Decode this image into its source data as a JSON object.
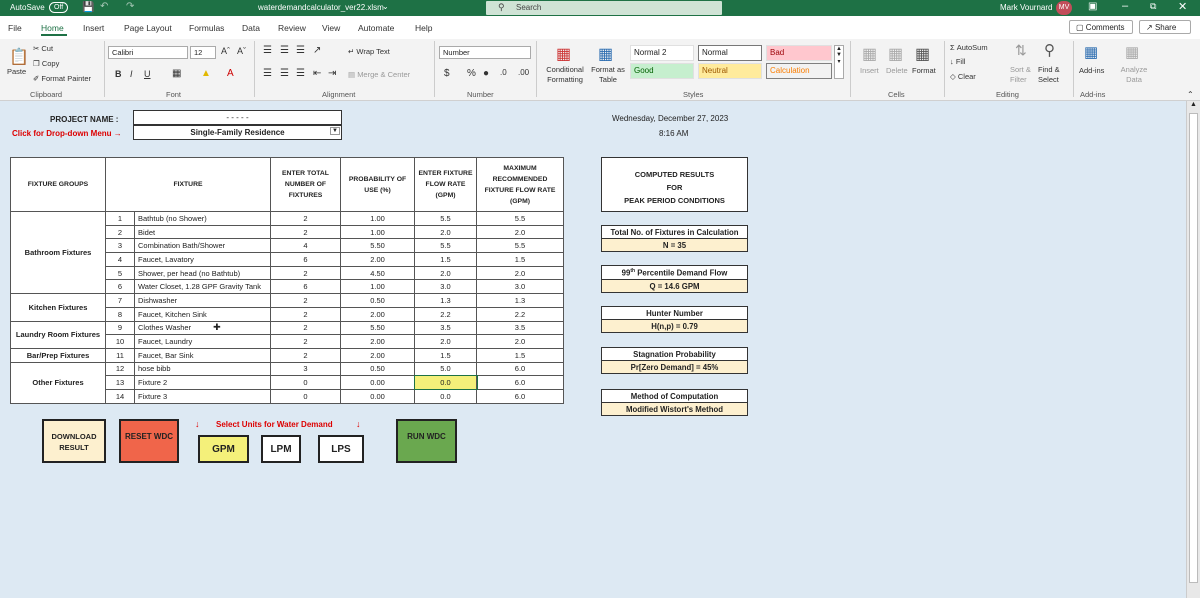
{
  "titlebar": {
    "autosave": "AutoSave",
    "autosave_state": "Off",
    "filename": "waterdemandcalculator_ver22.xlsm",
    "search": "Search",
    "user": "Mark Vournard",
    "initials": "MV"
  },
  "menu": {
    "tabs": [
      "File",
      "Home",
      "Insert",
      "Page Layout",
      "Formulas",
      "Data",
      "Review",
      "View",
      "Automate",
      "Help"
    ],
    "comments": "Comments",
    "share": "Share"
  },
  "ribbon": {
    "clipboard": {
      "paste": "Paste",
      "cut": "Cut",
      "copy": "Copy",
      "painter": "Format Painter",
      "label": "Clipboard"
    },
    "font": {
      "name": "Calibri",
      "size": "12",
      "label": "Font"
    },
    "alignment": {
      "wrap": "Wrap Text",
      "merge": "Merge & Center",
      "label": "Alignment"
    },
    "number": {
      "format": "Number",
      "label": "Number"
    },
    "styles": {
      "conditional": "Conditional Formatting",
      "format_table": "Format as Table",
      "normal2": "Normal 2",
      "normal": "Normal",
      "bad": "Bad",
      "good": "Good",
      "neutral": "Neutral",
      "calculation": "Calculation",
      "label": "Styles"
    },
    "cells": {
      "insert": "Insert",
      "delete": "Delete",
      "format": "Format",
      "label": "Cells"
    },
    "editing": {
      "autosum": "AutoSum",
      "fill": "Fill",
      "clear": "Clear",
      "sort": "Sort & Filter",
      "find": "Find & Select",
      "label": "Editing"
    },
    "addins": {
      "addins": "Add-ins",
      "analyze": "Analyze Data",
      "label": "Add-ins"
    }
  },
  "sheet": {
    "project_label": "PROJECT NAME :",
    "project_value": "- - - - -",
    "dropdown_label": "Click for Drop-down Menu →",
    "dropdown_value": "Single-Family Residence",
    "date": "Wednesday, December 27, 2023",
    "time": "8:16 AM",
    "headers": {
      "groups": "FIXTURE GROUPS",
      "fixture": "FIXTURE",
      "total": "ENTER TOTAL NUMBER OF FIXTURES",
      "prob": "PROBABILITY OF USE (%)",
      "flow": "ENTER FIXTURE FLOW RATE (GPM)",
      "max": "MAXIMUM RECOMMENDED FIXTURE FLOW RATE (GPM)"
    },
    "groups": {
      "bathroom": "Bathroom Fixtures",
      "kitchen": "Kitchen Fixtures",
      "laundry": "Laundry Room Fixtures",
      "bar": "Bar/Prep Fixtures",
      "other": "Other Fixtures"
    },
    "rows": [
      {
        "n": "1",
        "fixture": "Bathtub (no Shower)",
        "total": "2",
        "prob": "1.00",
        "flow": "5.5",
        "max": "5.5"
      },
      {
        "n": "2",
        "fixture": "Bidet",
        "total": "2",
        "prob": "1.00",
        "flow": "2.0",
        "max": "2.0"
      },
      {
        "n": "3",
        "fixture": "Combination Bath/Shower",
        "total": "4",
        "prob": "5.50",
        "flow": "5.5",
        "max": "5.5"
      },
      {
        "n": "4",
        "fixture": "Faucet, Lavatory",
        "total": "6",
        "prob": "2.00",
        "flow": "1.5",
        "max": "1.5"
      },
      {
        "n": "5",
        "fixture": "Shower, per head (no Bathtub)",
        "total": "2",
        "prob": "4.50",
        "flow": "2.0",
        "max": "2.0"
      },
      {
        "n": "6",
        "fixture": "Water Closet, 1.28 GPF Gravity Tank",
        "total": "6",
        "prob": "1.00",
        "flow": "3.0",
        "max": "3.0"
      },
      {
        "n": "7",
        "fixture": "Dishwasher",
        "total": "2",
        "prob": "0.50",
        "flow": "1.3",
        "max": "1.3"
      },
      {
        "n": "8",
        "fixture": "Faucet, Kitchen Sink",
        "total": "2",
        "prob": "2.00",
        "flow": "2.2",
        "max": "2.2"
      },
      {
        "n": "9",
        "fixture": "Clothes Washer",
        "total": "2",
        "prob": "5.50",
        "flow": "3.5",
        "max": "3.5"
      },
      {
        "n": "10",
        "fixture": "Faucet, Laundry",
        "total": "2",
        "prob": "2.00",
        "flow": "2.0",
        "max": "2.0"
      },
      {
        "n": "11",
        "fixture": "Faucet, Bar Sink",
        "total": "2",
        "prob": "2.00",
        "flow": "1.5",
        "max": "1.5"
      },
      {
        "n": "12",
        "fixture": "hose bibb",
        "total": "3",
        "prob": "0.50",
        "flow": "5.0",
        "max": "6.0"
      },
      {
        "n": "13",
        "fixture": "Fixture 2",
        "total": "0",
        "prob": "0.00",
        "flow": "0.0",
        "max": "6.0"
      },
      {
        "n": "14",
        "fixture": "Fixture 3",
        "total": "0",
        "prob": "0.00",
        "flow": "0.0",
        "max": "6.0"
      }
    ],
    "results": {
      "header": [
        "COMPUTED RESULTS",
        "FOR",
        "PEAK PERIOD CONDITIONS"
      ],
      "fixtures_title": "Total No. of Fixtures in Calculation",
      "fixtures_value": "N = 35",
      "percentile_title": "99",
      "percentile_sup": "th",
      "percentile_rest": "Percentile Demand Flow",
      "percentile_value": "Q = 14.6 GPM",
      "hunter_title": "Hunter Number",
      "hunter_value": "H(n,p) = 0.79",
      "stag_title": "Stagnation Probability",
      "stag_value": "Pr[Zero Demand] = 45%",
      "method_title": "Method of Computation",
      "method_value": "Modified Wistort's Method"
    },
    "buttons": {
      "download": "DOWNLOAD RESULT",
      "reset": "RESET WDC",
      "units_label": "Select Units for Water Demand",
      "gpm": "GPM",
      "lpm": "LPM",
      "lps": "LPS",
      "run": "RUN WDC"
    }
  }
}
